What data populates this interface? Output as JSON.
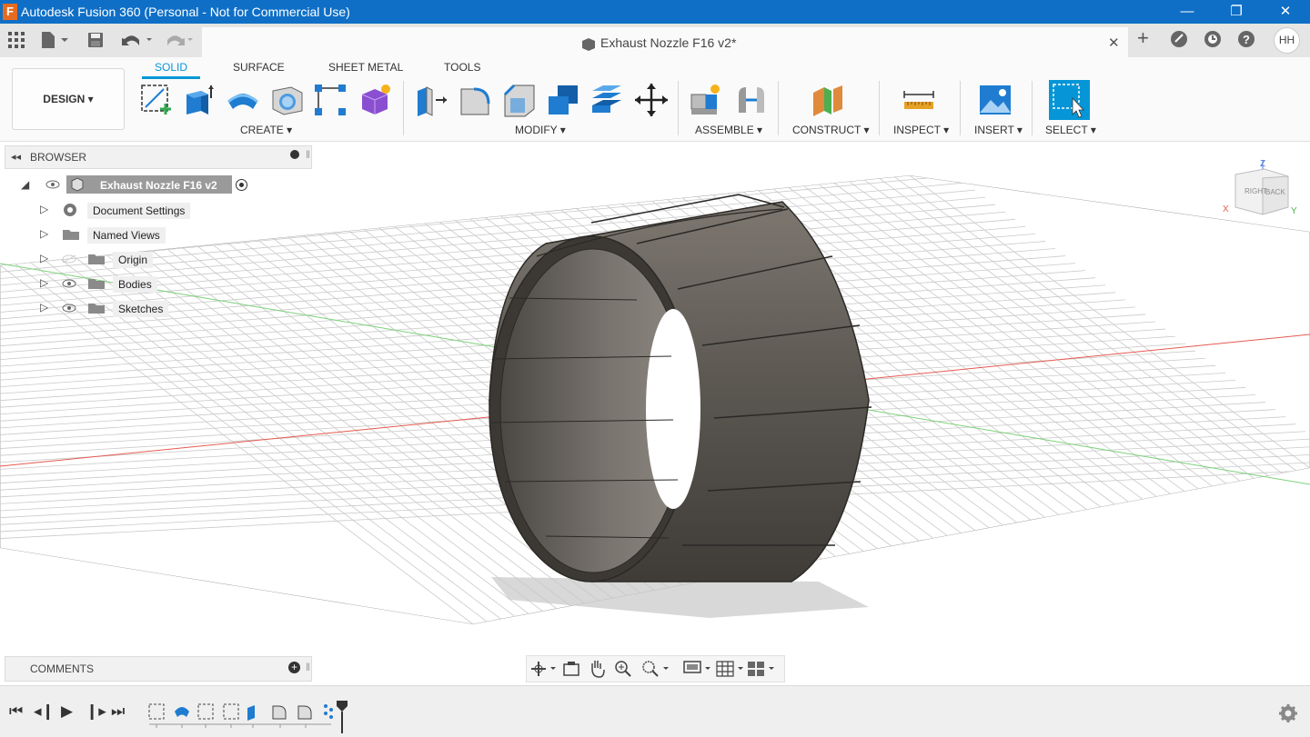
{
  "window": {
    "title": "Autodesk Fusion 360 (Personal - Not for Commercial Use)",
    "app_logo": "F",
    "minimize": "—",
    "restore": "❐",
    "close": "✕"
  },
  "tabs": {
    "apps_icon": "apps-grid-icon",
    "document_tab_label": "Exhaust Nozzle F16 v2*",
    "close_tab": "✕",
    "user_initials": "HH"
  },
  "toolbar": {
    "workspace": "DESIGN",
    "workspace_tabs": [
      {
        "label": "SOLID",
        "active": true
      },
      {
        "label": "SURFACE",
        "active": false
      },
      {
        "label": "SHEET METAL",
        "active": false
      },
      {
        "label": "TOOLS",
        "active": false
      }
    ],
    "groups": {
      "create": "CREATE",
      "modify": "MODIFY",
      "assemble": "ASSEMBLE",
      "construct": "CONSTRUCT",
      "inspect": "INSPECT",
      "insert": "INSERT",
      "select": "SELECT"
    },
    "caret": "▾"
  },
  "browser": {
    "title": "BROWSER",
    "root": "Exhaust Nozzle F16 v2",
    "items": [
      {
        "label": "Document Settings",
        "icon": "gear-icon"
      },
      {
        "label": "Named Views",
        "icon": "folder-icon"
      },
      {
        "label": "Origin",
        "icon": "folder-icon"
      },
      {
        "label": "Bodies",
        "icon": "folder-icon"
      },
      {
        "label": "Sketches",
        "icon": "folder-icon"
      }
    ]
  },
  "viewcube": {
    "axis_z": "Z",
    "axis_x": "X",
    "axis_y": "Y",
    "face_left": "RIGHT",
    "face_front": "BACK"
  },
  "comments": {
    "title": "COMMENTS",
    "add": "+"
  },
  "colors": {
    "titlebar": "#0f6fc6",
    "accent": "#0696d7",
    "x_axis": "#e0392f",
    "y_axis": "#4caf50",
    "body": "#5d5953"
  }
}
